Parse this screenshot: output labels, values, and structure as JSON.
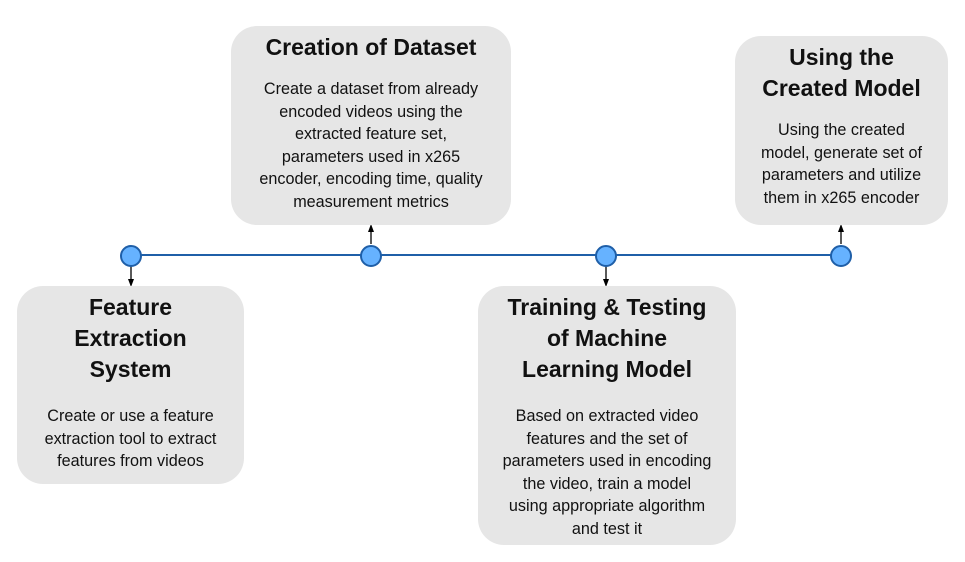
{
  "colors": {
    "timeline": "#1f5fa8",
    "node_fill": "#66b2ff",
    "node_stroke": "#1f5fa8",
    "arrow": "#000000",
    "card_bg": "#e6e6e6",
    "text": "#111111"
  },
  "stages": [
    {
      "title": "Feature\nExtraction\nSystem",
      "body": "Create or use a feature\nextraction tool to extract\nfeatures from videos"
    },
    {
      "title": "Creation of Dataset",
      "body": "Create a dataset from already\nencoded videos using the\nextracted feature set,\nparameters used in x265\nencoder, encoding time, quality\nmeasurement metrics"
    },
    {
      "title": "Training & Testing\nof Machine\nLearning Model",
      "body": "Based on extracted video\nfeatures and the set of\nparameters used in encoding\nthe video, train a model\nusing appropriate algorithm\nand test it"
    },
    {
      "title": "Using the\nCreated Model",
      "body": "Using the created\nmodel, generate set of\nparameters and utilize\nthem in x265 encoder"
    }
  ]
}
